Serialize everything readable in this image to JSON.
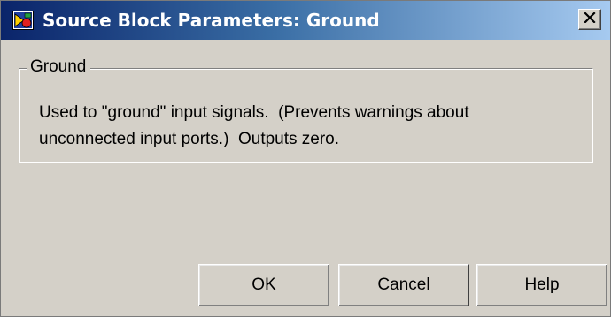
{
  "window": {
    "title": "Source Block Parameters: Ground",
    "icon": "simulink-block-icon",
    "close_icon": "close-icon",
    "close_label": "×"
  },
  "group": {
    "legend": "Ground",
    "description_lines": [
      "Used to \"ground\" input signals.  (Prevents warnings about",
      "unconnected input ports.)  Outputs zero."
    ]
  },
  "buttons": {
    "ok": "OK",
    "cancel": "Cancel",
    "help": "Help"
  },
  "colors": {
    "titlebar_start": "#0a246a",
    "titlebar_end": "#a6caf0",
    "dialog_face": "#d4d0c8"
  }
}
